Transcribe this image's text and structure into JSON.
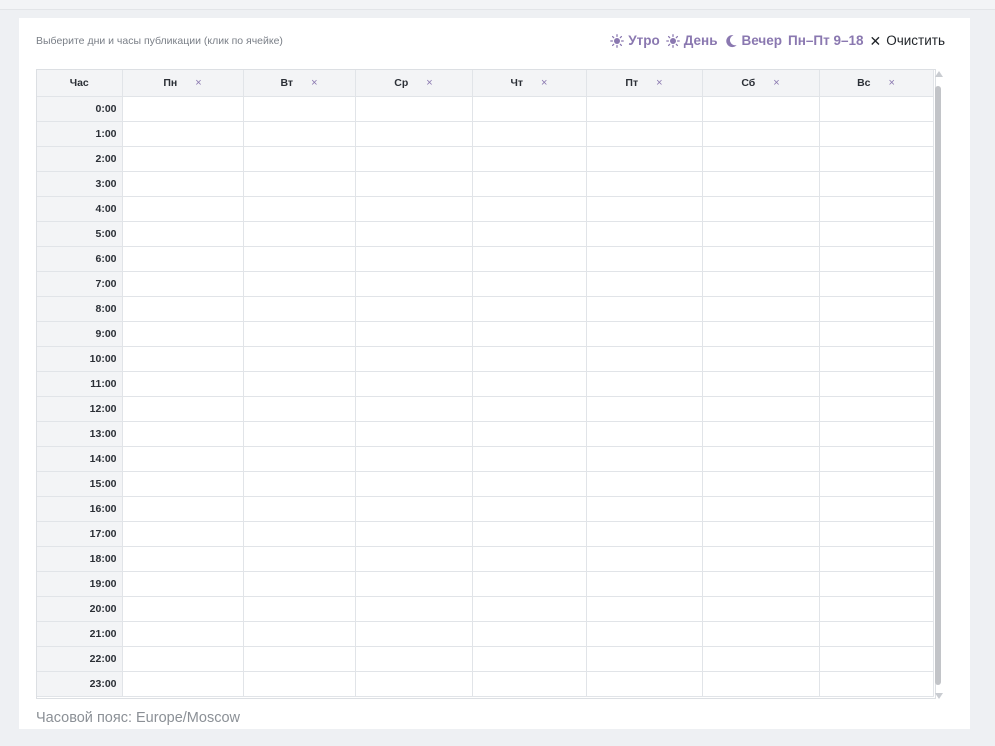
{
  "hint": "Выберите дни и часы публикации (клик по ячейке)",
  "presets": [
    {
      "label": "Утро",
      "icon": "sun-icon"
    },
    {
      "label": "День",
      "icon": "sun-icon"
    },
    {
      "label": "Вечер",
      "icon": "moon-icon"
    },
    {
      "label": "Пн–Пт 9–18",
      "icon": ""
    }
  ],
  "clear_label": "Очистить",
  "grid": {
    "hour_header": "Час",
    "days": [
      "Пн",
      "Вт",
      "Ср",
      "Чт",
      "Пт",
      "Сб",
      "Вс"
    ],
    "remove_day_symbol": "×",
    "hours": [
      "0:00",
      "1:00",
      "2:00",
      "3:00",
      "4:00",
      "5:00",
      "6:00",
      "7:00",
      "8:00",
      "9:00",
      "10:00",
      "11:00",
      "12:00",
      "13:00",
      "14:00",
      "15:00",
      "16:00",
      "17:00",
      "18:00",
      "19:00",
      "20:00",
      "21:00",
      "22:00",
      "23:00"
    ]
  },
  "timezone": "Часовой пояс: Europe/Moscow",
  "colors": {
    "accent": "#8a78b0"
  }
}
